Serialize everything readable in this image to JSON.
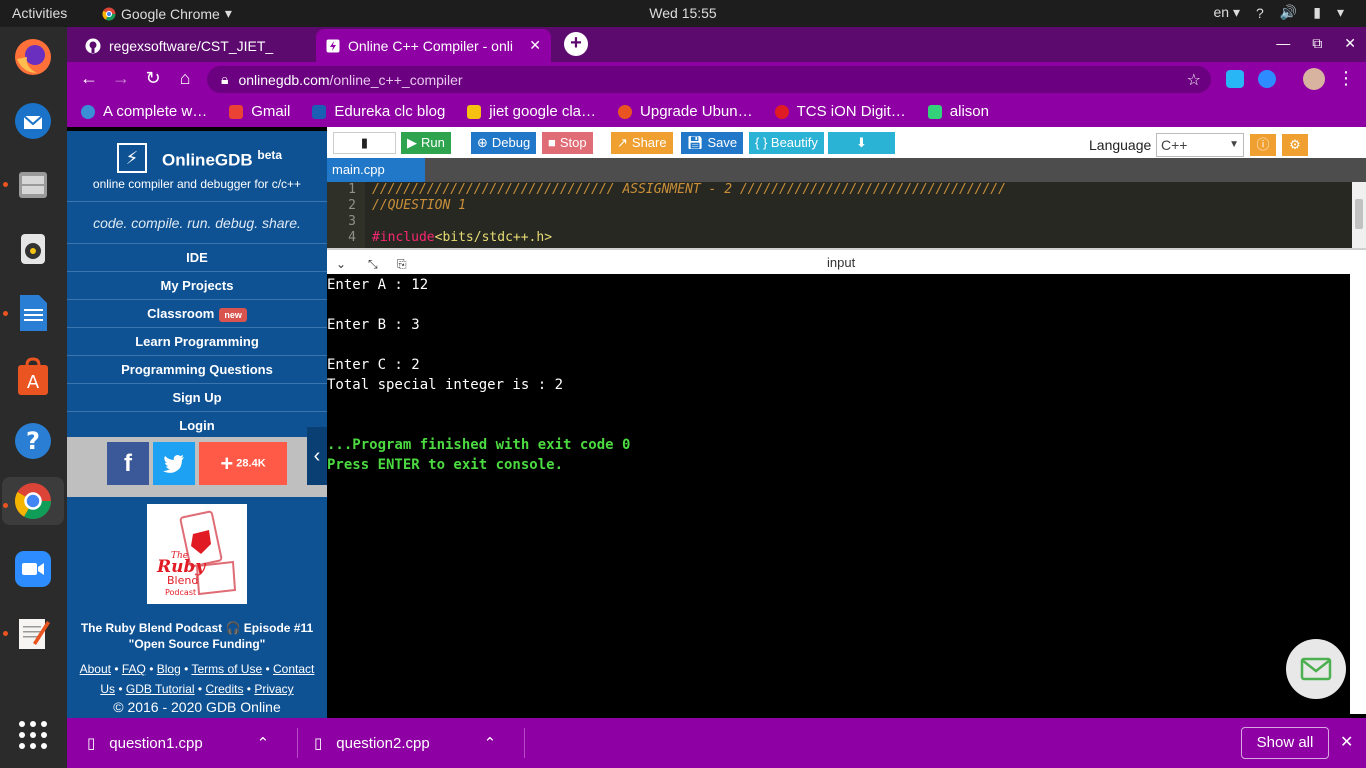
{
  "system": {
    "activities": "Activities",
    "app_name": "Google Chrome",
    "clock": "Wed 15:55",
    "lang": "en",
    "help": "?"
  },
  "browser": {
    "tabs": [
      {
        "title": "regexsoftware/CST_JIET_",
        "icon": "github-icon"
      },
      {
        "title": "Online C++ Compiler - onli",
        "icon": "onlinegdb-icon"
      }
    ],
    "url_host": "onlinegdb.com",
    "url_path": "/online_c++_compiler",
    "bookmarks": [
      {
        "label": "A complete w…",
        "color": "#3b8fd6"
      },
      {
        "label": "Gmail",
        "color": "#ea4335"
      },
      {
        "label": "Edureka clc  blog",
        "color": "#1a5fb4"
      },
      {
        "label": "jiet google cla…",
        "color": "#f5c211"
      },
      {
        "label": "Upgrade Ubun…",
        "color": "#e95420"
      },
      {
        "label": "TCS iON Digit…",
        "color": "#e01b24"
      },
      {
        "label": "alison",
        "color": "#33d17a"
      }
    ]
  },
  "sidebar": {
    "brand": "OnlineGDB",
    "brand_sup": "beta",
    "subtitle": "online compiler and debugger for c/c++",
    "tagline": "code. compile. run. debug. share.",
    "nav": [
      {
        "label": "IDE"
      },
      {
        "label": "My Projects"
      },
      {
        "label": "Classroom",
        "badge": "new"
      },
      {
        "label": "Learn Programming"
      },
      {
        "label": "Programming Questions"
      },
      {
        "label": "Sign Up"
      },
      {
        "label": "Login"
      }
    ],
    "share_count": "28.4K",
    "ad": {
      "img_line1": "The",
      "img_line2": "Ruby",
      "img_line3": "Blend",
      "img_line4": "Podcast",
      "caption1": "The Ruby Blend Podcast 🎧 Episode #11",
      "caption2": "\"Open Source Funding\""
    },
    "footer": {
      "about": "About",
      "faq": "FAQ",
      "blog": "Blog",
      "terms": "Terms of Use",
      "contact": "Contact",
      "us": "Us",
      "tutorial": "GDB Tutorial",
      "credits": "Credits",
      "privacy": "Privacy",
      "copyright": "© 2016 - 2020 GDB Online"
    }
  },
  "editor": {
    "buttons": {
      "run": "Run",
      "debug": "Debug",
      "stop": "Stop",
      "share": "Share",
      "save": "Save",
      "beautify": "{ } Beautify"
    },
    "language_label": "Language",
    "language_value": "C++",
    "file_tab": "main.cpp",
    "code_lines": [
      {
        "num": "1",
        "text": "/////////////////////////////// ASSIGNMENT - 2 //////////////////////////////////"
      },
      {
        "num": "2",
        "text": "//QUESTION 1"
      },
      {
        "num": "3",
        "text": ""
      },
      {
        "num": "4",
        "inc": "#include",
        "str": "<bits/stdc++.h>"
      }
    ],
    "io_label": "input",
    "console": [
      "Enter A : 12",
      "",
      "Enter B : 3",
      "",
      "Enter C : 2",
      "Total special integer is : 2"
    ],
    "finish1": "...Program finished with exit code 0",
    "finish2": "Press ENTER to exit console."
  },
  "downloads": {
    "items": [
      {
        "name": "question1.cpp"
      },
      {
        "name": "question2.cpp"
      }
    ],
    "show_all": "Show all"
  }
}
